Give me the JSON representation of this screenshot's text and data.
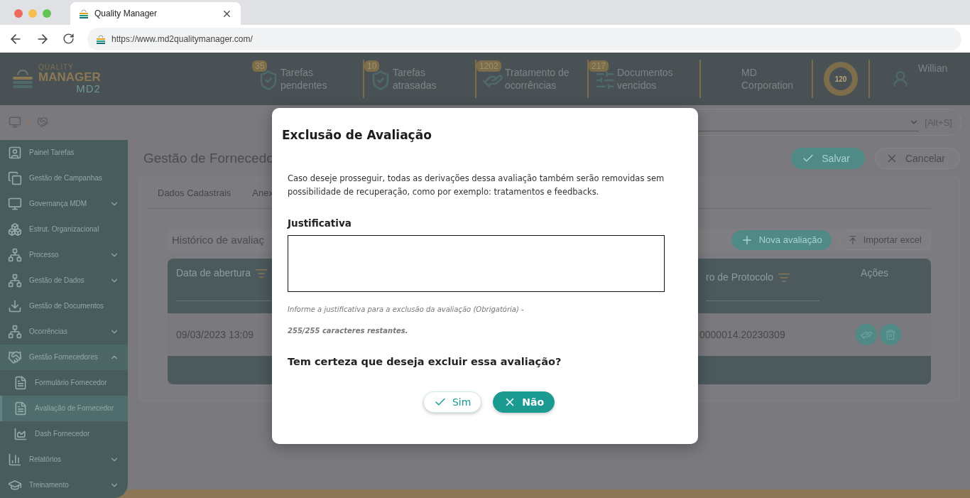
{
  "browser": {
    "tab_title": "Quality Manager",
    "url": "https://www.md2qualitymanager.com/"
  },
  "header": {
    "logo": {
      "line_1": "QUALITY",
      "line_2": "MANAGER",
      "line_3": "MD2"
    },
    "stats": [
      {
        "count": "35",
        "label": "Tarefas pendentes"
      },
      {
        "count": "10",
        "label": "Tarefas atrasadas"
      },
      {
        "count": "1202",
        "label": "Tratamento de ocorrências"
      },
      {
        "count": "217",
        "label": "Documentos vencidos"
      }
    ],
    "company": "MD Corporation",
    "score": "120",
    "user": "Willian"
  },
  "toolbar": {
    "shortcut": "[Alt+S]"
  },
  "sidebar": {
    "items": [
      {
        "label": "Painel Tarefas",
        "selected": false
      },
      {
        "label": "Gestão de Campanhas",
        "selected": false
      },
      {
        "label": "Governança MDM",
        "expanded": false,
        "selected": false
      },
      {
        "label": "Estrut. Organizacional",
        "selected": false
      },
      {
        "label": "Processo",
        "expanded": false,
        "selected": false
      },
      {
        "label": "Gestão de Dados",
        "expanded": false,
        "selected": false
      },
      {
        "label": "Gestão de Documentos",
        "selected": false
      },
      {
        "label": "Ocorrências",
        "expanded": false,
        "selected": false
      },
      {
        "label": "Gestão Fornecedores",
        "expanded": true,
        "selected": false,
        "children": [
          {
            "label": "Formulário Fornecedor",
            "selected": false
          },
          {
            "label": "Avaliação de Fornecedor",
            "selected": true
          },
          {
            "label": "Dash Fornecedor",
            "selected": false
          }
        ]
      },
      {
        "label": "Relatórios",
        "expanded": false,
        "selected": false
      },
      {
        "label": "Treinamento",
        "expanded": false,
        "selected": false
      }
    ]
  },
  "page": {
    "title": "Gestão de Fornecedo",
    "actions": [
      {
        "label": "Salvar",
        "kind": "primary"
      },
      {
        "label": "Cancelar",
        "kind": "secondary"
      }
    ],
    "tabs": [
      "Dados Cadastrais",
      "Anex"
    ],
    "section": {
      "title": "Histórico de avaliaç",
      "buttons": [
        {
          "label": "Nova avaliação",
          "kind": "primary"
        },
        {
          "label": "Importar excel",
          "kind": "secondary"
        }
      ]
    },
    "table": {
      "columns": [
        "Data de abertura",
        "ro de Protocolo",
        "Ações"
      ],
      "rows": [
        {
          "cells": [
            "09/03/2023 13:09",
            "0000014.20230309"
          ]
        }
      ]
    }
  },
  "dialog": {
    "title": "Exclusão de Avaliação",
    "message": "Caso deseje prosseguir, todas as derivações dessa avaliação também serão removidas sem possibilidade de recuperação, como por exemplo: tratamentos e feedbacks.",
    "field_label": "Justificativa",
    "hint": "Informe a justificativa para a exclusão da avaliação (Obrigatória) -",
    "counter": "255/255 caracteres restantes.",
    "question": "Tem certeza que deseja excluir essa avaliação?",
    "buttons": [
      {
        "label": "Sim",
        "kind": "confirm"
      },
      {
        "label": "Não",
        "kind": "cancel"
      }
    ]
  }
}
